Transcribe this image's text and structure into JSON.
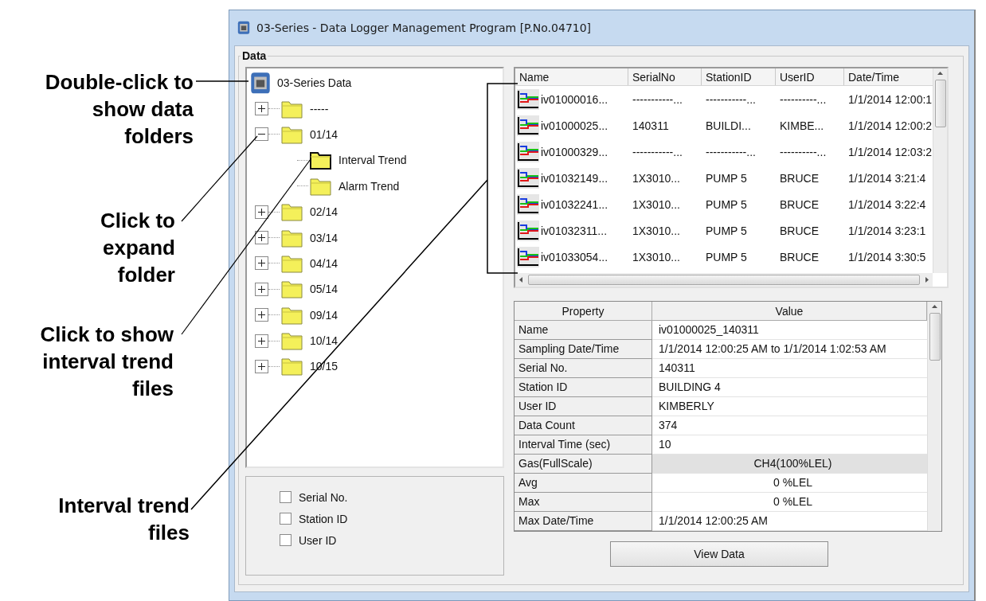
{
  "annotations": [
    {
      "text": "Double-click to\nshow data\nfolders"
    },
    {
      "text": "Click to\nexpand\nfolder"
    },
    {
      "text": "Click to show\ninterval trend\nfiles"
    },
    {
      "text": "Interval trend\nfiles"
    }
  ],
  "window": {
    "title": "03-Series  - Data Logger Management Program [P.No.04710]"
  },
  "group": {
    "label": "Data"
  },
  "tree": {
    "label": "03-Series Data",
    "selected": false,
    "children": [
      {
        "label": "-----",
        "expanded": false,
        "selected": false
      },
      {
        "label": "01/14",
        "expanded": true,
        "selected": false,
        "children": [
          {
            "label": "Interval Trend",
            "selected": true
          },
          {
            "label": "Alarm Trend",
            "selected": false
          }
        ]
      },
      {
        "label": "02/14",
        "expanded": false,
        "selected": false
      },
      {
        "label": "03/14",
        "expanded": false,
        "selected": false
      },
      {
        "label": "04/14",
        "expanded": false,
        "selected": false
      },
      {
        "label": "05/14",
        "expanded": false,
        "selected": false
      },
      {
        "label": "09/14",
        "expanded": false,
        "selected": false
      },
      {
        "label": "10/14",
        "expanded": false,
        "selected": false
      },
      {
        "label": "10/15",
        "expanded": false,
        "selected": false
      }
    ]
  },
  "filters": [
    {
      "label": "Serial No.",
      "checked": false
    },
    {
      "label": "Station ID",
      "checked": false
    },
    {
      "label": "User ID",
      "checked": false
    }
  ],
  "file_list": {
    "columns": [
      "Name",
      "SerialNo",
      "StationID",
      "UserID",
      "Date/Time"
    ],
    "rows": [
      [
        "iv01000016...",
        "-----------...",
        "-----------...",
        "----------...",
        "1/1/2014 12:00:1"
      ],
      [
        "iv01000025...",
        "140311",
        "BUILDI...",
        "KIMBE...",
        "1/1/2014 12:00:2"
      ],
      [
        "iv01000329...",
        "-----------...",
        "-----------...",
        "----------...",
        "1/1/2014 12:03:2"
      ],
      [
        "iv01032149...",
        "1X3010...",
        "PUMP 5",
        "BRUCE",
        "1/1/2014 3:21:4"
      ],
      [
        "iv01032241...",
        "1X3010...",
        "PUMP 5",
        "BRUCE",
        "1/1/2014 3:22:4"
      ],
      [
        "iv01032311...",
        "1X3010...",
        "PUMP 5",
        "BRUCE",
        "1/1/2014 3:23:1"
      ],
      [
        "iv01033054...",
        "1X3010...",
        "PUMP 5",
        "BRUCE",
        "1/1/2014 3:30:5"
      ]
    ]
  },
  "properties": {
    "columns": [
      "Property",
      "Value"
    ],
    "rows": [
      {
        "kind": "text",
        "property": "Name",
        "value": "iv01000025_140311"
      },
      {
        "kind": "text",
        "property": "Sampling Date/Time",
        "value": "1/1/2014 12:00:25 AM to 1/1/2014 1:02:53 AM"
      },
      {
        "kind": "text",
        "property": "Serial No.",
        "value": "140311"
      },
      {
        "kind": "text",
        "property": "Station ID",
        "value": "BUILDING 4"
      },
      {
        "kind": "text",
        "property": "User ID",
        "value": "KIMBERLY"
      },
      {
        "kind": "text",
        "property": "Data Count",
        "value": "374"
      },
      {
        "kind": "text",
        "property": "Interval Time (sec)",
        "value": "10"
      },
      {
        "kind": "gas",
        "property": "Gas(FullScale)",
        "value": "CH4(100%LEL)"
      },
      {
        "kind": "reading",
        "property": "Avg",
        "value": "0 %LEL"
      },
      {
        "kind": "reading",
        "property": "Max",
        "value": "0 %LEL"
      },
      {
        "kind": "text",
        "property": "Max Date/Time",
        "value": "1/1/2014 12:00:25 AM"
      }
    ]
  },
  "button": {
    "label": "View Data"
  }
}
